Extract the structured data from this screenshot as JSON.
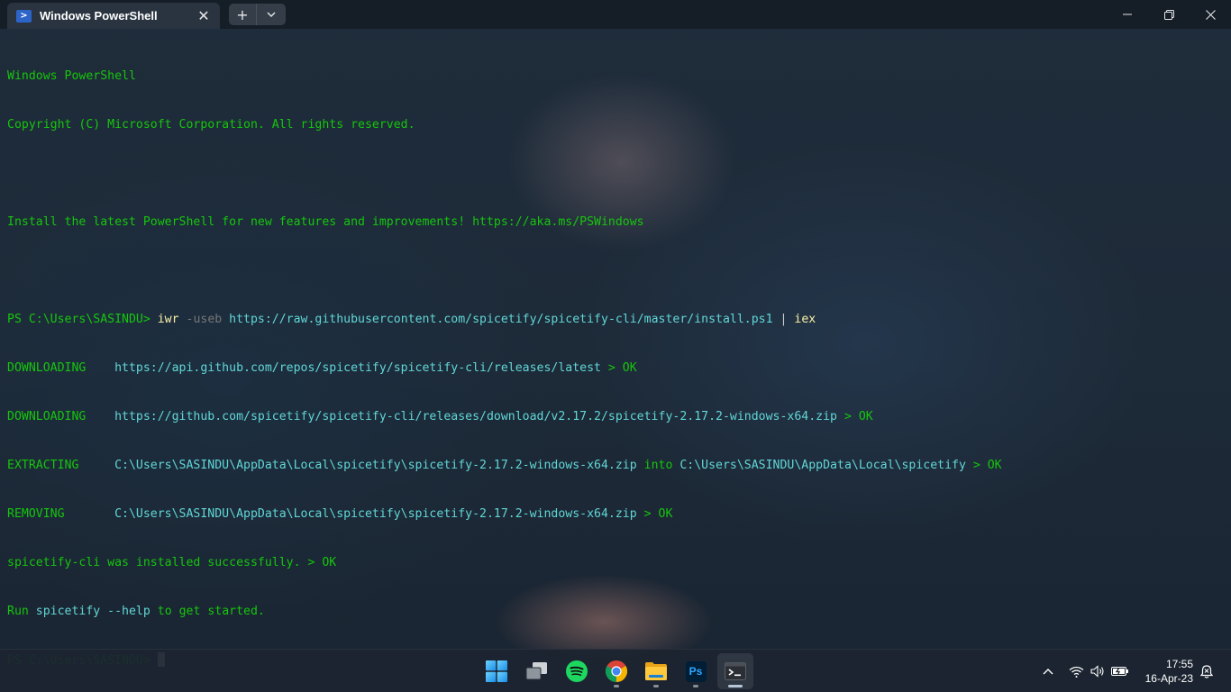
{
  "window": {
    "tab_title": "Windows PowerShell",
    "tab_icon": "powershell-icon",
    "tab_close_glyph": "✕",
    "new_tab_glyph": "+",
    "dropdown_glyph": "⌄",
    "minimize_glyph": "—",
    "maximize_glyph": "❐",
    "close_glyph": "✕"
  },
  "terminal": {
    "banner_1": "Windows PowerShell",
    "banner_2": "Copyright (C) Microsoft Corporation. All rights reserved.",
    "install_hint": "Install the latest PowerShell for new features and improvements! https://aka.ms/PSWindows",
    "prompt": "PS C:\\Users\\SASINDU> ",
    "cmd_iwr": "iwr",
    "cmd_flag": " -useb",
    "cmd_url": " https://raw.githubusercontent.com/spicetify/spicetify-cli/master/install.ps1",
    "cmd_pipe": " | ",
    "cmd_iex": "iex",
    "log": [
      {
        "label": "DOWNLOADING    ",
        "path": "https://api.github.com/repos/spicetify/spicetify-cli/releases/latest",
        "mid": "",
        "path2": "",
        "status": " > OK"
      },
      {
        "label": "DOWNLOADING    ",
        "path": "https://github.com/spicetify/spicetify-cli/releases/download/v2.17.2/spicetify-2.17.2-windows-x64.zip",
        "mid": "",
        "path2": "",
        "status": " > OK"
      },
      {
        "label": "EXTRACTING     ",
        "path": "C:\\Users\\SASINDU\\AppData\\Local\\spicetify\\spicetify-2.17.2-windows-x64.zip",
        "mid": " into ",
        "path2": "C:\\Users\\SASINDU\\AppData\\Local\\spicetify",
        "status": " > OK"
      },
      {
        "label": "REMOVING       ",
        "path": "C:\\Users\\SASINDU\\AppData\\Local\\spicetify\\spicetify-2.17.2-windows-x64.zip",
        "mid": "",
        "path2": "",
        "status": " > OK"
      }
    ],
    "success": "spicetify-cli was installed successfully. > OK",
    "run_pre": "Run ",
    "run_cmd": "spicetify --help",
    "run_post": " to get started."
  },
  "taskbar": {
    "apps": [
      "start-icon",
      "task-view-icon",
      "spotify-icon",
      "chrome-icon",
      "file-explorer-icon",
      "photoshop-icon",
      "terminal-icon"
    ],
    "photoshop_label": "Ps",
    "tray_chevron": "^",
    "time": "17:55",
    "date": "16-Apr-23"
  },
  "colors": {
    "terminal_green": "#16c60c",
    "terminal_cyan": "#61d6d6",
    "terminal_yellow": "#f9f1a5",
    "terminal_gray": "#767676"
  }
}
